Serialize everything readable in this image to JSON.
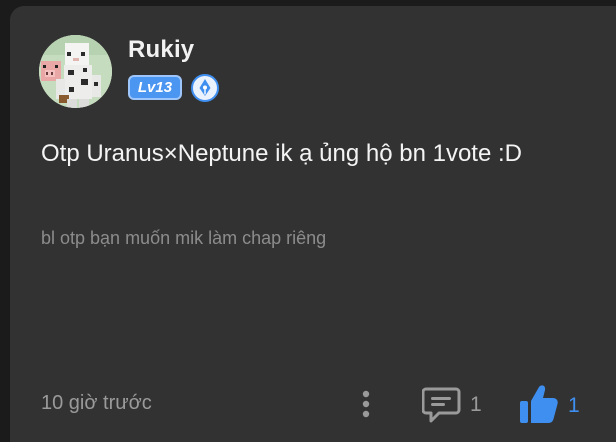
{
  "user": {
    "name": "Rukiy",
    "level": "Lv13",
    "avatar_icon": "minecraft-skin-avatar",
    "rank_icon": "pen-nib-rank-icon"
  },
  "comment": {
    "text": "Otp Uranus×Neptune ik ạ ủng hộ bn 1vote :D",
    "reference": "bl otp bạn muốn mik làm chap riêng",
    "timestamp": "10 giờ trước"
  },
  "actions": {
    "more_icon": "more-vertical-icon",
    "reply_icon": "comment-icon",
    "reply_count": "1",
    "like_icon": "thumbs-up-icon",
    "like_count": "1"
  },
  "colors": {
    "background": "#323232",
    "accent": "#3f8ff0",
    "badge": "#4a96f0"
  }
}
